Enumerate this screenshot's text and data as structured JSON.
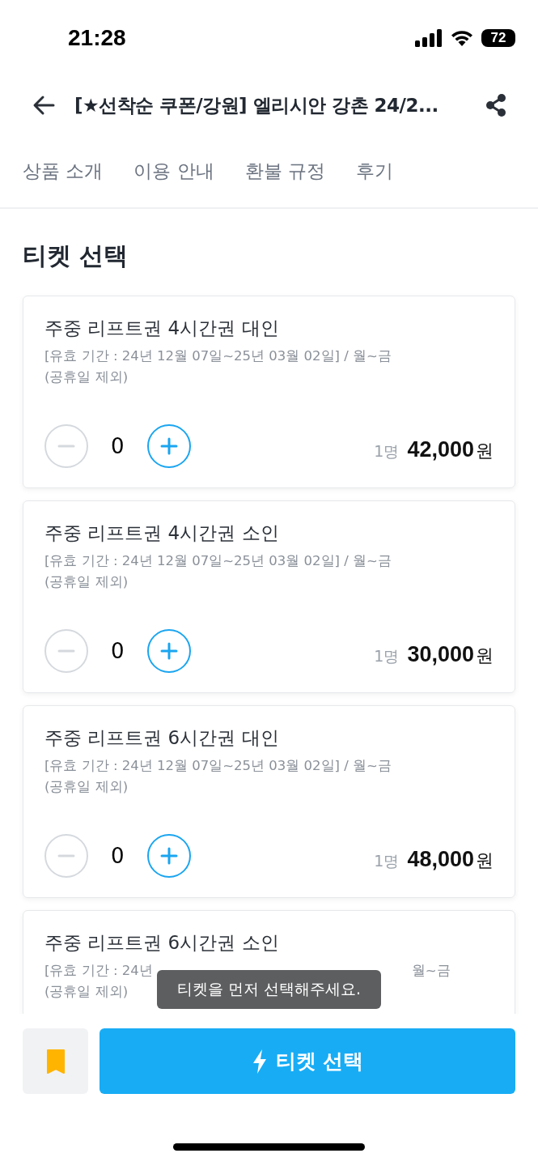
{
  "status_bar": {
    "time": "21:28",
    "battery": "72"
  },
  "header": {
    "title": "[★선착순 쿠폰/강원] 엘리시안 강촌 24/2..."
  },
  "tabs": [
    {
      "label": "상품 소개",
      "selected": false
    },
    {
      "label": "이용 안내",
      "selected": false
    },
    {
      "label": "환불 규정",
      "selected": false
    },
    {
      "label": "후기",
      "selected": false
    }
  ],
  "section_title": "티켓 선택",
  "tickets": [
    {
      "name": "주중 리프트권 4시간권 대인",
      "validity": [
        "[유효 기간 : 24년 12월 07일~25년 03월 02일] / 월~금"
      ],
      "note": "(공휴일 제외)",
      "count": "0",
      "minus_disabled": true,
      "unit": "1명",
      "price": "42,000",
      "currency": "원"
    },
    {
      "name": "주중 리프트권 4시간권 소인",
      "validity": [
        "[유효 기간 : 24년 12월 07일~25년 03월 02일] / 월~금"
      ],
      "note": "(공휴일 제외)",
      "count": "0",
      "minus_disabled": true,
      "unit": "1명",
      "price": "30,000",
      "currency": "원"
    },
    {
      "name": "주중 리프트권 6시간권 대인",
      "validity": [
        "[유효 기간 : 24년 12월 07일~25년 03월 02일] / 월~금"
      ],
      "note": "(공휴일 제외)",
      "count": "0",
      "minus_disabled": true,
      "unit": "1명",
      "price": "48,000",
      "currency": "원"
    },
    {
      "name": "주중 리프트권  6시간권 소인",
      "validity": [
        "[유효 기간 : 24년",
        "월~금"
      ],
      "note": "(공휴일 제외)"
    }
  ],
  "toast": "티켓을 먼저 선택해주세요.",
  "bottom_bar": {
    "bookmarked": true,
    "button": "티켓 선택"
  }
}
